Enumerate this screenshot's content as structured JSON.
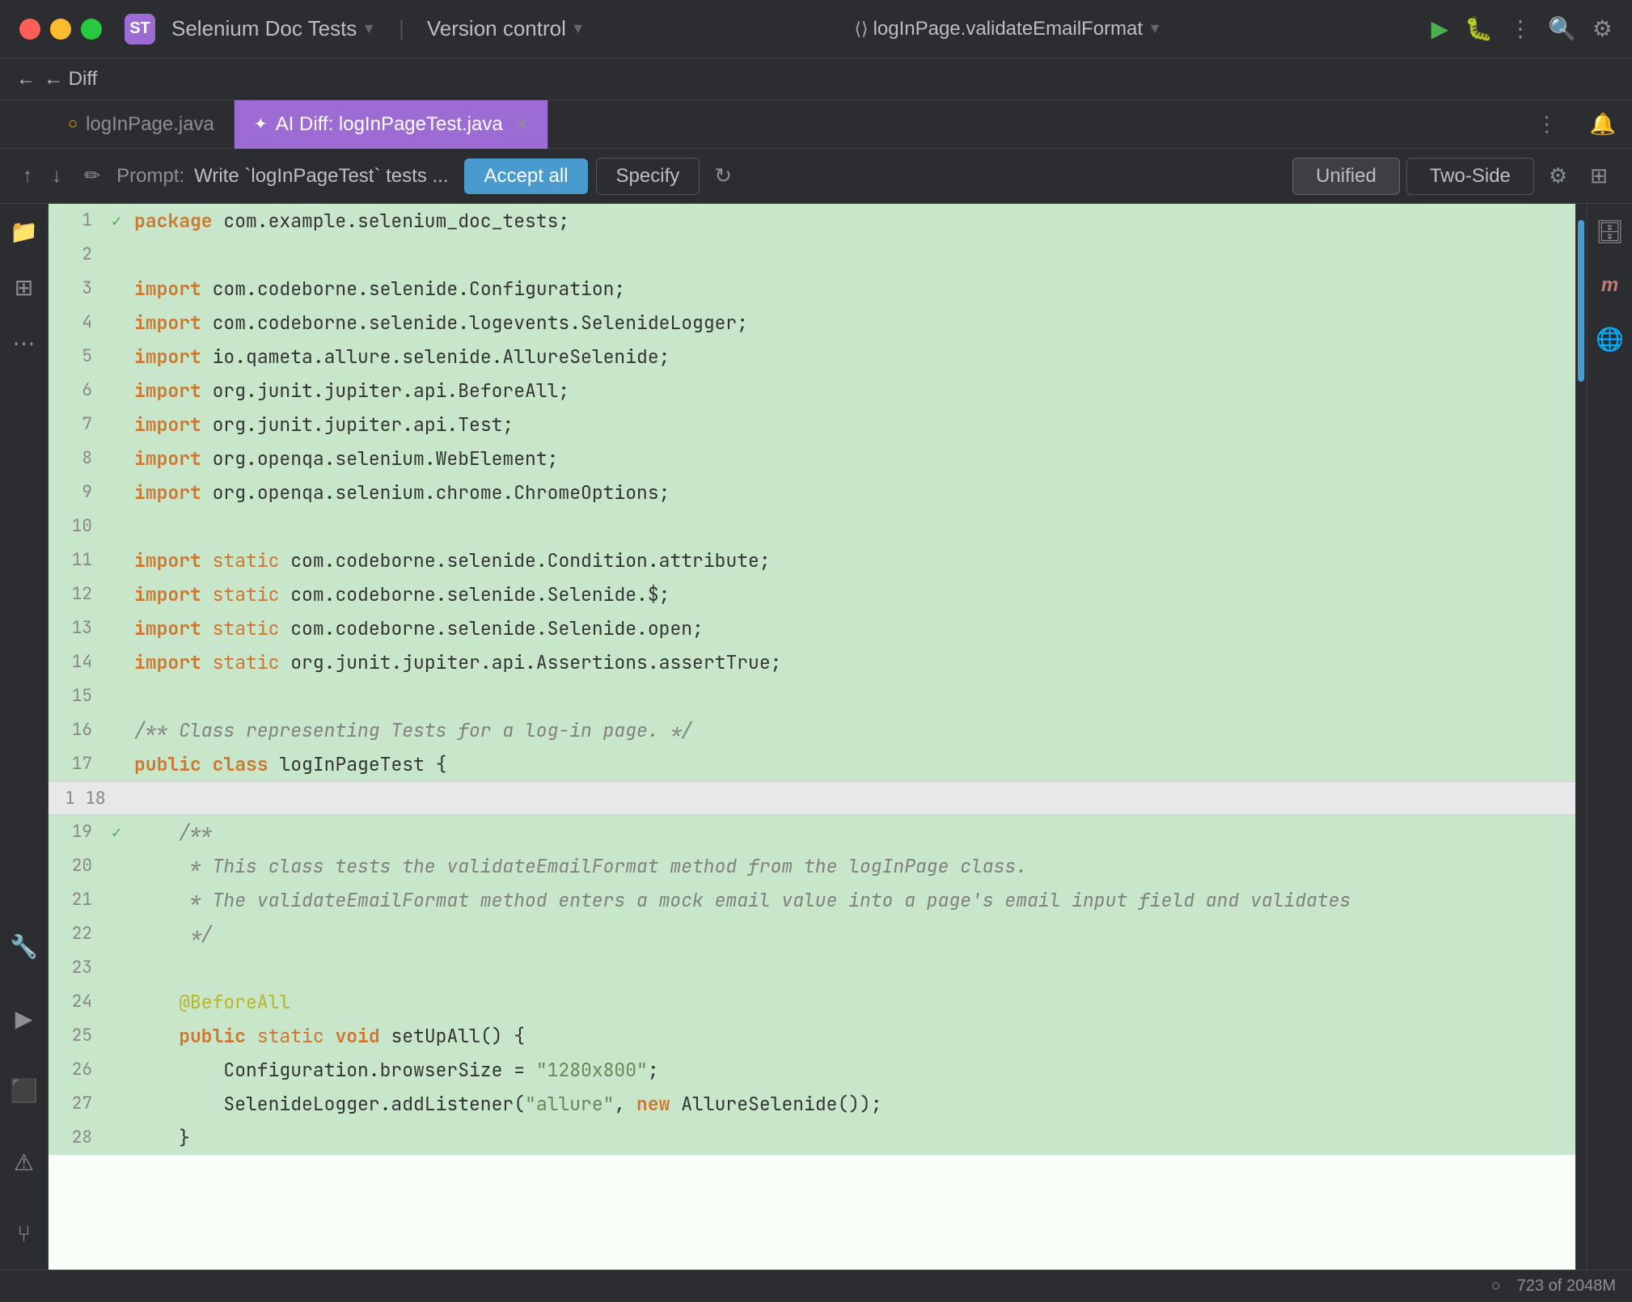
{
  "titlebar": {
    "app_icon_label": "ST",
    "project_name": "Selenium Doc Tests",
    "project_chevron": "▼",
    "vcs_label": "Version control",
    "vcs_chevron": "▼",
    "file_path": "logInPage.validateEmailFormat",
    "file_chevron": "▼",
    "run_icon": "▶",
    "debug_icon": "🐛",
    "more_icon": "⋮",
    "search_icon": "🔍",
    "settings_icon": "⚙"
  },
  "diff_bar": {
    "back_label": "← Diff"
  },
  "tabs": [
    {
      "id": "tab-loginpage",
      "icon": "○",
      "label": "logInPage.java",
      "active": false
    },
    {
      "id": "tab-ai-diff",
      "icon": "✦",
      "label": "AI Diff: logInPageTest.java",
      "active": true,
      "closable": true
    }
  ],
  "promptbar": {
    "prompt_label": "Prompt:",
    "prompt_text": "Write `logInPageTest` tests ...",
    "accept_all_label": "Accept all",
    "specify_label": "Specify",
    "refresh_icon": "↻",
    "unified_label": "Unified",
    "two_side_label": "Two-Side",
    "settings_icon": "⚙",
    "layout_icon": "⊞"
  },
  "code": {
    "lines": [
      {
        "num": "1",
        "check": "✓",
        "content": "package com.example.selenium_doc_tests;",
        "green": true
      },
      {
        "num": "2",
        "check": "",
        "content": "",
        "green": true
      },
      {
        "num": "3",
        "check": "",
        "content": "import com.codeborne.selenide.Configuration;",
        "green": true
      },
      {
        "num": "4",
        "check": "",
        "content": "import com.codeborne.selenide.logevents.SelenideLogger;",
        "green": true
      },
      {
        "num": "5",
        "check": "",
        "content": "import io.qameta.allure.selenide.AllureSelenide;",
        "green": true
      },
      {
        "num": "6",
        "check": "",
        "content": "import org.junit.jupiter.api.BeforeAll;",
        "green": true
      },
      {
        "num": "7",
        "check": "",
        "content": "import org.junit.jupiter.api.Test;",
        "green": true
      },
      {
        "num": "8",
        "check": "",
        "content": "import org.openqa.selenium.WebElement;",
        "green": true
      },
      {
        "num": "9",
        "check": "",
        "content": "import org.openqa.selenium.chrome.ChromeOptions;",
        "green": true
      },
      {
        "num": "10",
        "check": "",
        "content": "",
        "green": true
      },
      {
        "num": "11",
        "check": "",
        "content": "import static com.codeborne.selenide.Condition.attribute;",
        "green": true
      },
      {
        "num": "12",
        "check": "",
        "content": "import static com.codeborne.selenide.Selenide.$;",
        "green": true
      },
      {
        "num": "13",
        "check": "",
        "content": "import static com.codeborne.selenide.Selenide.open;",
        "green": true
      },
      {
        "num": "14",
        "check": "",
        "content": "import static org.junit.jupiter.api.Assertions.assertTrue;",
        "green": true
      },
      {
        "num": "15",
        "check": "",
        "content": "",
        "green": true
      },
      {
        "num": "16",
        "check": "",
        "content": "/** Class representing Tests for a log-in page. */",
        "green": true
      },
      {
        "num": "17",
        "check": "",
        "content": "public class logInPageTest {",
        "green": true
      }
    ],
    "separator_line": {
      "num": "1 18",
      "content": ""
    },
    "lines2": [
      {
        "num": "19",
        "check": "✓",
        "content": "    /**",
        "green": true
      },
      {
        "num": "20",
        "check": "",
        "content": "     * This class tests the validateEmailFormat method from the logInPage class.",
        "green": true
      },
      {
        "num": "21",
        "check": "",
        "content": "     * The validateEmailFormat method enters a mock email value into a page's email input field and validates",
        "green": true
      },
      {
        "num": "22",
        "check": "",
        "content": "     */",
        "green": true
      },
      {
        "num": "23",
        "check": "",
        "content": "",
        "green": true
      },
      {
        "num": "24",
        "check": "",
        "content": "    @BeforeAll",
        "green": true
      },
      {
        "num": "25",
        "check": "",
        "content": "    public static void setUpAll() {",
        "green": true
      },
      {
        "num": "26",
        "check": "",
        "content": "        Configuration.browserSize = \"1280x800\";",
        "green": true
      },
      {
        "num": "27",
        "check": "",
        "content": "        SelenideLogger.addListener(\"allure\", new AllureSelenide());",
        "green": true
      },
      {
        "num": "28",
        "check": "",
        "content": "    }",
        "green": true
      }
    ]
  },
  "statusbar": {
    "icon": "○",
    "text": "723 of 2048M"
  },
  "sidebar_left": {
    "icons": [
      "≡",
      "⊞",
      "⋯"
    ]
  },
  "sidebar_right": {
    "icons": [
      "≡",
      "m",
      "⊕"
    ]
  }
}
